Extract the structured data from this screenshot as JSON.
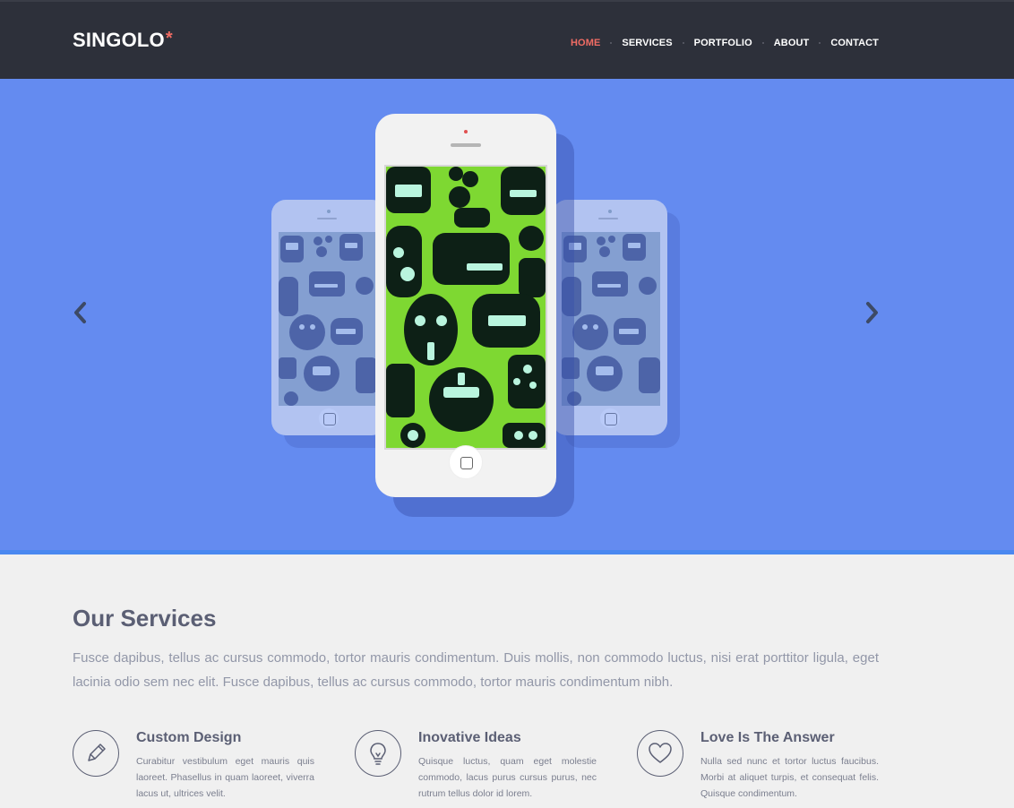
{
  "header": {
    "logo_text": "SINGOLO",
    "logo_star": "*",
    "nav": [
      {
        "label": "HOME",
        "active": true
      },
      {
        "label": "SERVICES",
        "active": false
      },
      {
        "label": "PORTFOLIO",
        "active": false
      },
      {
        "label": "ABOUT",
        "active": false
      },
      {
        "label": "CONTACT",
        "active": false
      }
    ]
  },
  "slider": {
    "prev_icon": "chevron-left-icon",
    "next_icon": "chevron-right-icon",
    "background_color": "#648bf0",
    "center_screen_color": "#7ed832",
    "side_screen_color": "#9fb0b8"
  },
  "services": {
    "title": "Our Services",
    "lead": "Fusce dapibus, tellus ac cursus commodo, tortor mauris condimentum. Duis mollis, non commodo luctus, nisi erat porttitor ligula, eget lacinia odio sem nec elit. Fusce dapibus, tellus ac cursus commodo, tortor mauris condimentum nibh.",
    "items": [
      {
        "title": "Custom Design",
        "icon": "pencil-icon",
        "text": "Curabitur vestibulum eget mauris quis laoreet. Phasellus in quam laoreet, viverra lacus ut, ultrices velit."
      },
      {
        "title": "Inovative Ideas",
        "icon": "lightbulb-icon",
        "text": "Quisque luctus, quam eget molestie commodo, lacus purus cursus purus, nec rutrum tellus dolor id lorem."
      },
      {
        "title": "Love Is The Answer",
        "icon": "heart-icon",
        "text": "Nulla sed nunc et tortor luctus faucibus. Morbi at aliquet turpis, et consequat felis. Quisque condimentum."
      }
    ]
  }
}
